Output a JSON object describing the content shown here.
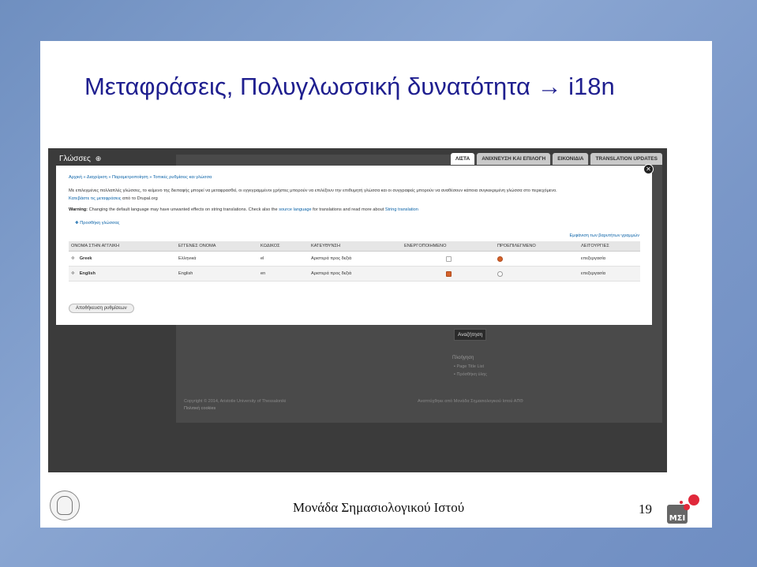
{
  "slide": {
    "title": "Μεταφράσεις, Πολυγλωσσική δυνατότητα   → i18n",
    "footer": "Μονάδα Σημασιολογικού Ιστού",
    "page_number": "19",
    "logo_text": "ΜΣΙ"
  },
  "overlay": {
    "title": "Γλώσσες",
    "title_icon": "plus-circle-icon",
    "tabs": [
      "ΛΙΣΤΑ",
      "ΑΝΙΧΝΕΥΣΗ ΚΑΙ ΕΠΙΛΟΓΗ",
      "ΕΙΚΟΝΙΔΙΑ",
      "TRANSLATION UPDATES"
    ],
    "active_tab": "ΛΙΣΤΑ",
    "breadcrumb": "Αρχική » Διαχείριση » Παραμετροποίηση » Τοπικές ρυθμίσεις και γλώσσα",
    "intro_text": "Με επιλεγμένες πολλαπλές γλώσσες, το κείμενο της διεπαφής μπορεί να μεταφρασθεί, οι εγγεγραμμένοι χρήστες μπορούν να επιλέξουν την επιθυμητή γλώσσα και οι συγγραφείς μπορούν να αναθέσουν κάποια συγκεκριμένη γλώσσα στο περιεχόμενο.",
    "download_link": "Κατεβάστε τις μεταφράσεις",
    "download_rest": "από το Drupal.org",
    "warning_label": "Warning:",
    "warning_text_1": "Changing the default language may have unwanted effects on string translations. Check also the",
    "warning_link_1": "source language",
    "warning_text_2": "for translations and read more about",
    "warning_link_2": "String translation",
    "add_language": "Προσθήκη γλώσσας",
    "show_weights": "Εμφάνιση των βαρυτήτων γραμμών",
    "columns": [
      "ΟΝΟΜΑ ΣΤΗΝ ΑΓΓΛΙΚΗ",
      "ΕΓΓΕΝΕΣ ΟΝΟΜΑ",
      "ΚΩΔΙΚΟΣ",
      "ΚΑΤΕΥΘΥΝΣΗ",
      "ΕΝΕΡΓΟΠΟΙΗΜΕΝΟ",
      "ΠΡΟΕΠΙΛΕΓΜΕΝΟ",
      "ΛΕΙΤΟΥΡΓΙΕΣ"
    ],
    "rows": [
      {
        "english": "Greek",
        "native": "Ελληνικά",
        "code": "el",
        "direction": "Αριστερά προς δεξιά",
        "enabled": false,
        "default": true,
        "op": "επεξεργασία"
      },
      {
        "english": "English",
        "native": "English",
        "code": "en",
        "direction": "Αριστερά προς δεξιά",
        "enabled": true,
        "default": false,
        "op": "επεξεργασία"
      }
    ],
    "save_button": "Αποθήκευση ρυθμίσεων"
  },
  "background_page": {
    "search_button": "Αναζήτηση",
    "nav_heading": "Πλοήγηση",
    "nav_items": [
      "Page Title List",
      "Πρόσθήκη ύλης"
    ],
    "copyright": "Copyright © 2014, Aristotle University of Thessaloniki",
    "privacy": "Πολιτική cookies",
    "credits": "Αναπτύχθηκε από Μονάδα Σημασιολογικού Ιστού ΑΠΘ"
  },
  "colors": {
    "title": "#1f1f8f",
    "accent": "#d4622a",
    "link": "#0b63a8"
  }
}
